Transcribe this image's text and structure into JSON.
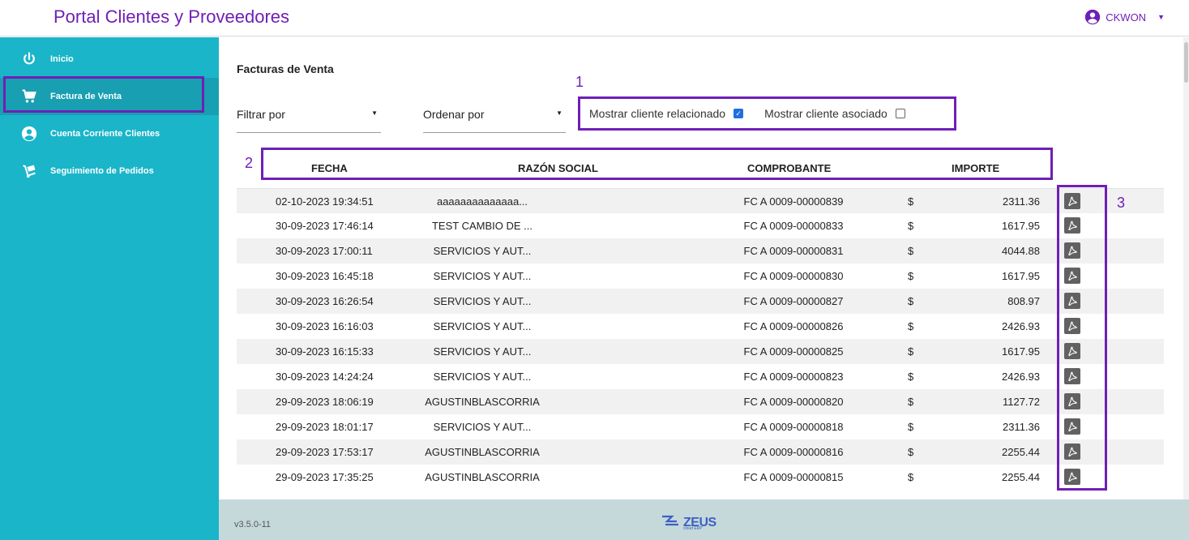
{
  "app": {
    "title": "Portal Clientes y Proveedores",
    "user": "CKWON"
  },
  "sidebar": {
    "items": [
      {
        "label": "Inicio",
        "icon": "power-icon"
      },
      {
        "label": "Factura de Venta",
        "icon": "cart-icon"
      },
      {
        "label": "Cuenta Corriente Clientes",
        "icon": "account-circle-icon"
      },
      {
        "label": "Seguimiento de Pedidos",
        "icon": "hand-truck-icon"
      }
    ]
  },
  "main": {
    "title": "Facturas de Venta",
    "filter_label": "Filtrar por",
    "sort_label": "Ordenar por",
    "check_related_label": "Mostrar cliente relacionado",
    "check_related_checked": true,
    "check_associated_label": "Mostrar cliente asociado",
    "check_associated_checked": false,
    "annotations": {
      "one": "1",
      "two": "2",
      "three": "3"
    }
  },
  "table": {
    "headers": {
      "fecha": "FECHA",
      "razon": "RAZÓN SOCIAL",
      "comprobante": "COMPROBANTE",
      "importe": "IMPORTE"
    },
    "currency": "$",
    "rows": [
      {
        "fecha": "02-10-2023 19:34:51",
        "razon": "aaaaaaaaaaaaaa...",
        "comprobante": "FC A 0009-00000839",
        "importe": "2311.36"
      },
      {
        "fecha": "30-09-2023 17:46:14",
        "razon": "TEST CAMBIO DE ...",
        "comprobante": "FC A 0009-00000833",
        "importe": "1617.95"
      },
      {
        "fecha": "30-09-2023 17:00:11",
        "razon": "SERVICIOS Y AUT...",
        "comprobante": "FC A 0009-00000831",
        "importe": "4044.88"
      },
      {
        "fecha": "30-09-2023 16:45:18",
        "razon": "SERVICIOS Y AUT...",
        "comprobante": "FC A 0009-00000830",
        "importe": "1617.95"
      },
      {
        "fecha": "30-09-2023 16:26:54",
        "razon": "SERVICIOS Y AUT...",
        "comprobante": "FC A 0009-00000827",
        "importe": "808.97"
      },
      {
        "fecha": "30-09-2023 16:16:03",
        "razon": "SERVICIOS Y AUT...",
        "comprobante": "FC A 0009-00000826",
        "importe": "2426.93"
      },
      {
        "fecha": "30-09-2023 16:15:33",
        "razon": "SERVICIOS Y AUT...",
        "comprobante": "FC A 0009-00000825",
        "importe": "1617.95"
      },
      {
        "fecha": "30-09-2023 14:24:24",
        "razon": "SERVICIOS Y AUT...",
        "comprobante": "FC A 0009-00000823",
        "importe": "2426.93"
      },
      {
        "fecha": "29-09-2023 18:06:19",
        "razon": "AGUSTINBLASCORRIA",
        "comprobante": "FC A 0009-00000820",
        "importe": "1127.72"
      },
      {
        "fecha": "29-09-2023 18:01:17",
        "razon": "SERVICIOS Y AUT...",
        "comprobante": "FC A 0009-00000818",
        "importe": "2311.36"
      },
      {
        "fecha": "29-09-2023 17:53:17",
        "razon": "AGUSTINBLASCORRIA",
        "comprobante": "FC A 0009-00000816",
        "importe": "2255.44"
      },
      {
        "fecha": "29-09-2023 17:35:25",
        "razon": "AGUSTINBLASCORRIA",
        "comprobante": "FC A 0009-00000815",
        "importe": "2255.44"
      }
    ]
  },
  "footer": {
    "version": "v3.5.0-11",
    "brand": "ZEUS",
    "brand_sub": "cloud ERP"
  },
  "colors": {
    "accent": "#6f1fb6",
    "sidebar": "#1ab5c9",
    "footer": "#c5d9da"
  }
}
